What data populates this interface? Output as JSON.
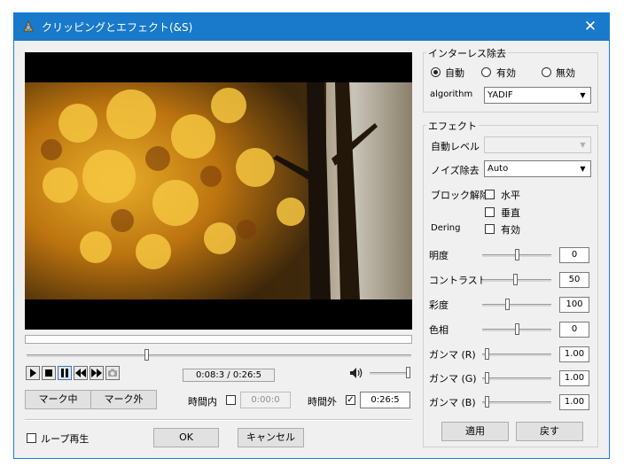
{
  "window": {
    "title": "クリッピングとエフェクト(&S)",
    "close": "✕"
  },
  "video": {
    "time_display": "0:08:3 / 0:26:5",
    "seek_progress": 0.31,
    "volume_level": 1.0
  },
  "mark": {
    "mark_in": "マーク中",
    "mark_out": "マーク外"
  },
  "time_in": {
    "label": "時間内",
    "checked": false,
    "value": "0:00:0"
  },
  "time_out": {
    "label": "時間外",
    "checked": true,
    "value": "0:26:5"
  },
  "loop": {
    "label": "ループ再生",
    "checked": false
  },
  "dialog": {
    "ok": "OK",
    "cancel": "キャンセル"
  },
  "deinterlace": {
    "group_label": "インターレス除去",
    "options": [
      "自動",
      "有効",
      "無効"
    ],
    "selected": "自動",
    "algorithm_label": "algorithm",
    "algorithm_value": "YADIF"
  },
  "effect": {
    "group_label": "エフェクト",
    "auto_level_label": "自動レベル",
    "auto_level_value": "",
    "noise_label": "ノイズ除去",
    "noise_value": "Auto",
    "deblock_label": "ブロック解除",
    "horizontal_label": "水平",
    "vertical_label": "垂直",
    "dering_label": "Dering",
    "dering_enable_label": "有効",
    "sliders": [
      {
        "label": "明度",
        "value": "0",
        "level": 0.5
      },
      {
        "label": "コントラスト",
        "value": "50",
        "level": 0.48
      },
      {
        "label": "彩度",
        "value": "100",
        "level": 0.35
      },
      {
        "label": "色相",
        "value": "0",
        "level": 0.5
      },
      {
        "label": "ガンマ (R)",
        "value": "1.00",
        "level": 0.04
      },
      {
        "label": "ガンマ (G)",
        "value": "1.00",
        "level": 0.04
      },
      {
        "label": "ガンマ (B)",
        "value": "1.00",
        "level": 0.04
      }
    ],
    "apply": "適用",
    "revert": "戻す"
  },
  "icons": {
    "play": "play-icon",
    "stop": "stop-icon",
    "pause": "pause-icon",
    "rewind": "rewind-icon",
    "forward": "fast-forward-icon",
    "snapshot": "camera-icon",
    "volume": "speaker-icon"
  }
}
